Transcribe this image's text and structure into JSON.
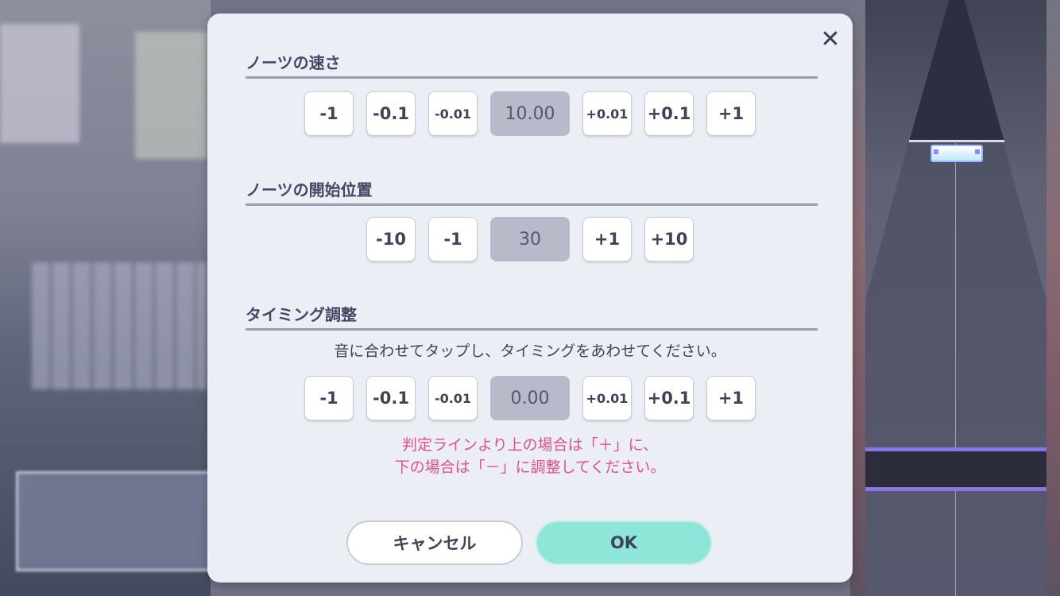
{
  "dialog": {
    "close_icon_glyph": "✕",
    "speed": {
      "title": "ノーツの速さ",
      "buttons_minus": [
        "-1",
        "-0.1",
        "-0.01"
      ],
      "value": "10.00",
      "buttons_plus": [
        "+0.01",
        "+0.1",
        "+1"
      ]
    },
    "start_position": {
      "title": "ノーツの開始位置",
      "buttons_minus": [
        "-10",
        "-1"
      ],
      "value": "30",
      "buttons_plus": [
        "+1",
        "+10"
      ]
    },
    "timing": {
      "title": "タイミング調整",
      "description": "音に合わせてタップし、タイミングをあわせてください。",
      "buttons_minus": [
        "-1",
        "-0.1",
        "-0.01"
      ],
      "value": "0.00",
      "buttons_plus": [
        "+0.01",
        "+0.1",
        "+1"
      ],
      "hint_line1": "判定ラインより上の場合は「＋」に、",
      "hint_line2": "下の場合は「－」に調整してください。"
    },
    "cancel_label": "キャンセル",
    "ok_label": "OK"
  },
  "colors": {
    "dialog_bg": "#eceef5",
    "ok_button": "#8ee6d8",
    "hint_text": "#e0508e",
    "value_box": "#b8b9c9"
  }
}
